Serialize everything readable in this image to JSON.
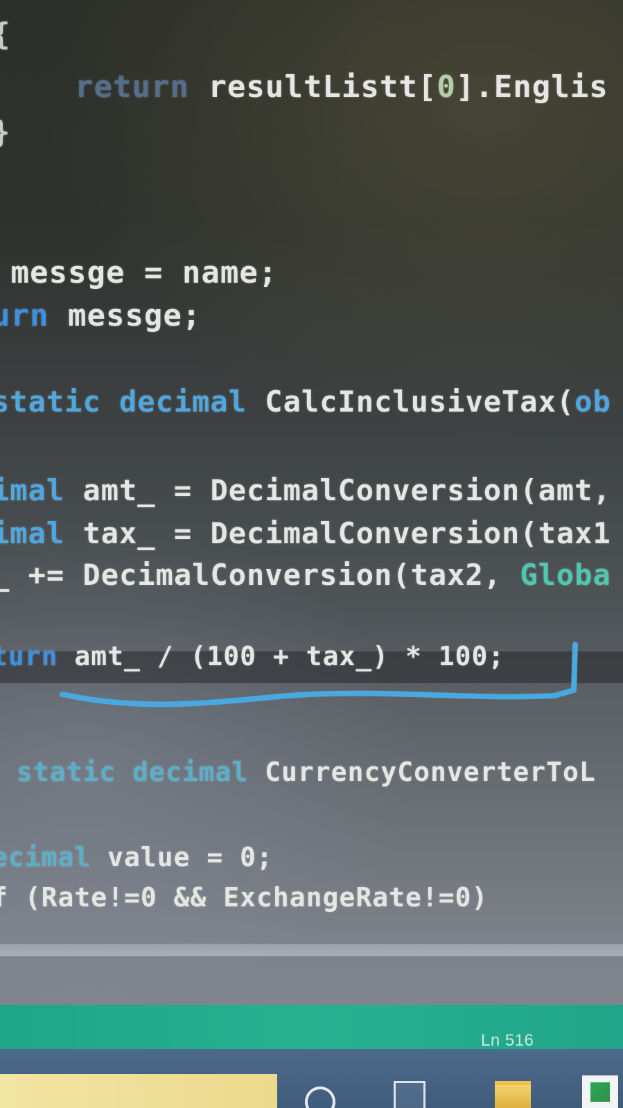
{
  "editor": {
    "lines": [
      {
        "id": "l1",
        "tokens": [
          {
            "t": "{",
            "c": ""
          }
        ]
      },
      {
        "id": "l2",
        "tokens": [
          {
            "t": "return",
            "c": "dim"
          },
          {
            "t": " resultListt[",
            "c": ""
          },
          {
            "t": "0",
            "c": "num"
          },
          {
            "t": "].Englis",
            "c": ""
          }
        ]
      },
      {
        "id": "l3",
        "tokens": [
          {
            "t": "}",
            "c": ""
          }
        ]
      },
      {
        "id": "l4",
        "tokens": [
          {
            "t": " messge = name;",
            "c": ""
          }
        ]
      },
      {
        "id": "l5",
        "tokens": [
          {
            "t": "urn",
            "c": "kw"
          },
          {
            "t": " messge;",
            "c": ""
          }
        ]
      },
      {
        "id": "l6",
        "tokens": [
          {
            "t": "static decimal",
            "c": "ty"
          },
          {
            "t": " CalcInclusiveTax(",
            "c": ""
          },
          {
            "t": "ob",
            "c": "ty"
          }
        ]
      },
      {
        "id": "l7",
        "tokens": [
          {
            "t": "imal",
            "c": "ty"
          },
          {
            "t": " amt_ = DecimalConversion(amt,",
            "c": ""
          }
        ]
      },
      {
        "id": "l8",
        "tokens": [
          {
            "t": "imal",
            "c": "ty"
          },
          {
            "t": " tax_ = DecimalConversion(tax1",
            "c": ""
          }
        ]
      },
      {
        "id": "l9",
        "tokens": [
          {
            "t": "_ += DecimalConversion(tax2, ",
            "c": ""
          },
          {
            "t": "Globa",
            "c": "gl"
          }
        ]
      },
      {
        "id": "l10",
        "tokens": [
          {
            "t": "turn",
            "c": "kw"
          },
          {
            "t": " amt_ / (100 + tax_) * 100;",
            "c": ""
          }
        ]
      },
      {
        "id": "l11",
        "tokens": [
          {
            "t": "static decimal",
            "c": "ty"
          },
          {
            "t": " CurrencyConverterToL",
            "c": ""
          }
        ]
      },
      {
        "id": "l12",
        "tokens": [
          {
            "t": "ecimal",
            "c": "ty"
          },
          {
            "t": " value = 0;",
            "c": ""
          }
        ]
      },
      {
        "id": "l13",
        "tokens": [
          {
            "t": "f (Rate!=0 && ExchangeRate!=0)",
            "c": ""
          }
        ]
      }
    ],
    "highlighted_line": "l10"
  },
  "status_bar": {
    "line_indicator": "Ln 516",
    "color": "#27b18f"
  },
  "taskbar": {
    "icons": [
      "cortana-icon",
      "task-view-icon",
      "file-explorer-icon",
      "store-icon"
    ]
  },
  "annotation": {
    "color": "#4aa8e0"
  }
}
